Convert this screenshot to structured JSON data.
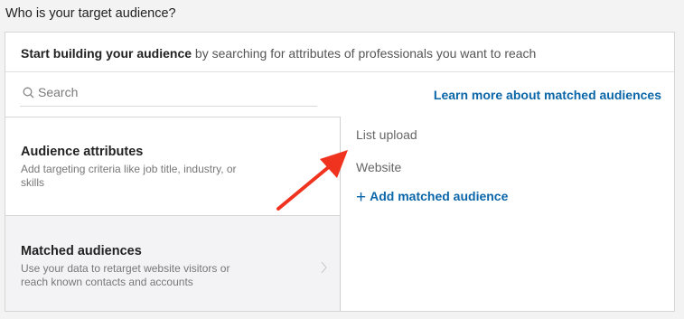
{
  "heading": "Who is your target audience?",
  "intro": {
    "bold": "Start building your audience",
    "rest": " by searching for attributes of professionals you want to reach"
  },
  "search": {
    "placeholder": "Search",
    "icon": "search-icon"
  },
  "learn_more": "Learn more about matched audiences",
  "left_menu": {
    "attributes": {
      "title": "Audience attributes",
      "description": "Add targeting criteria like job title, industry, or skills"
    },
    "matched": {
      "title": "Matched audiences",
      "description": "Use your data to retarget website visitors or reach known contacts and accounts",
      "icon": "chevron-right-icon"
    }
  },
  "options": [
    "List upload",
    "Website"
  ],
  "add_matched": "Add matched audience",
  "colors": {
    "link": "#0a66a8",
    "arrow": "#f0331f",
    "selected_bg": "#f3f3f5"
  }
}
